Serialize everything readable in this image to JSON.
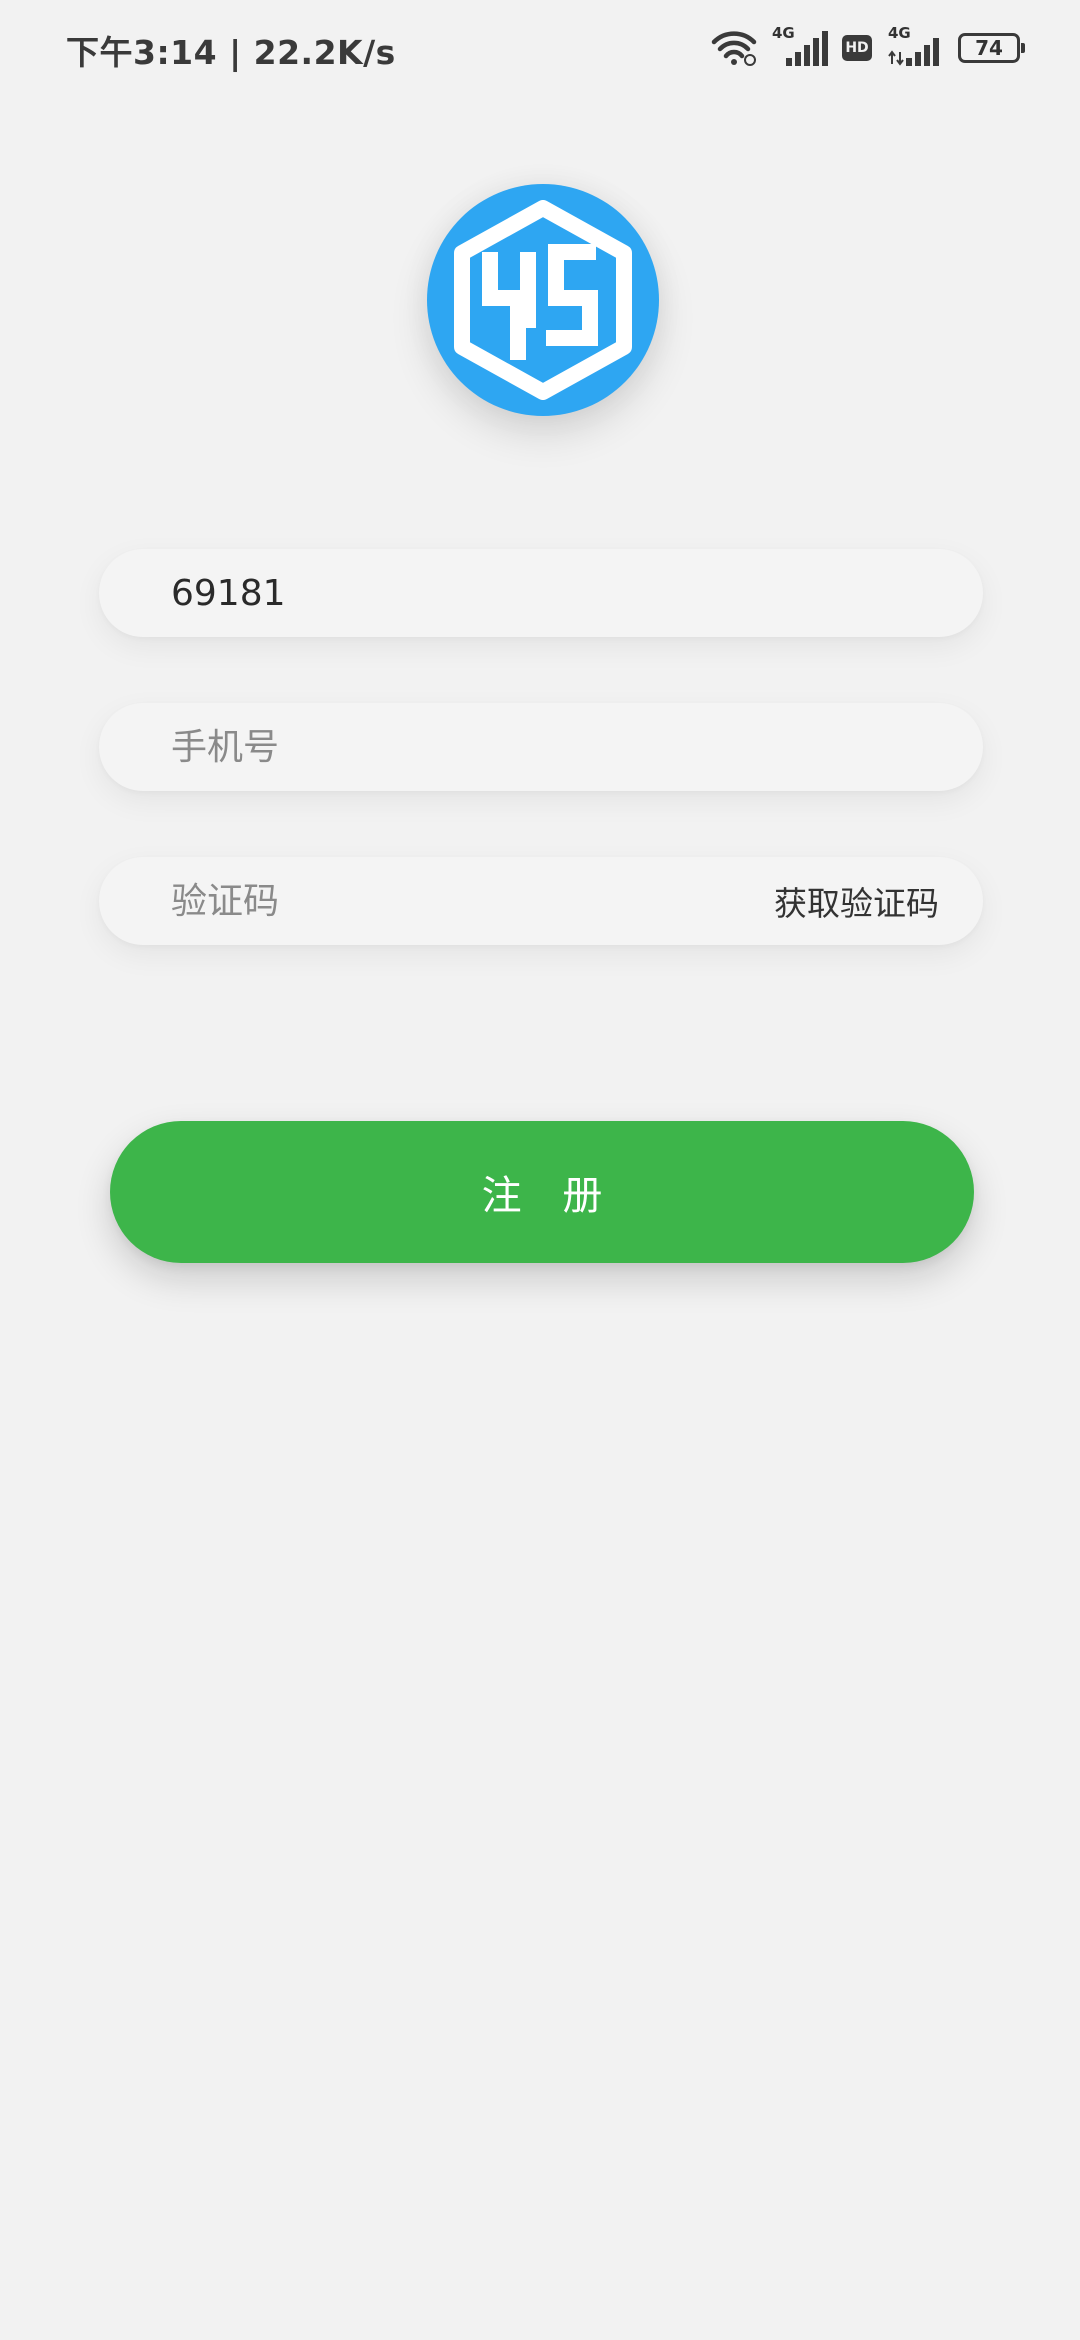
{
  "status_bar": {
    "time_speed": "下午3:14 | 22.2K/s",
    "net1_label": "4G",
    "hd_label": "HD",
    "net2_label": "4G",
    "battery": "74"
  },
  "form": {
    "username_value": "69181",
    "phone_placeholder": "手机号",
    "code_placeholder": "验证码",
    "get_code_label": "获取验证码",
    "register_label": "注 册"
  },
  "colors": {
    "background": "#f2f2f2",
    "logo_blue": "#2ea6f2",
    "button_green": "#3db54a"
  }
}
